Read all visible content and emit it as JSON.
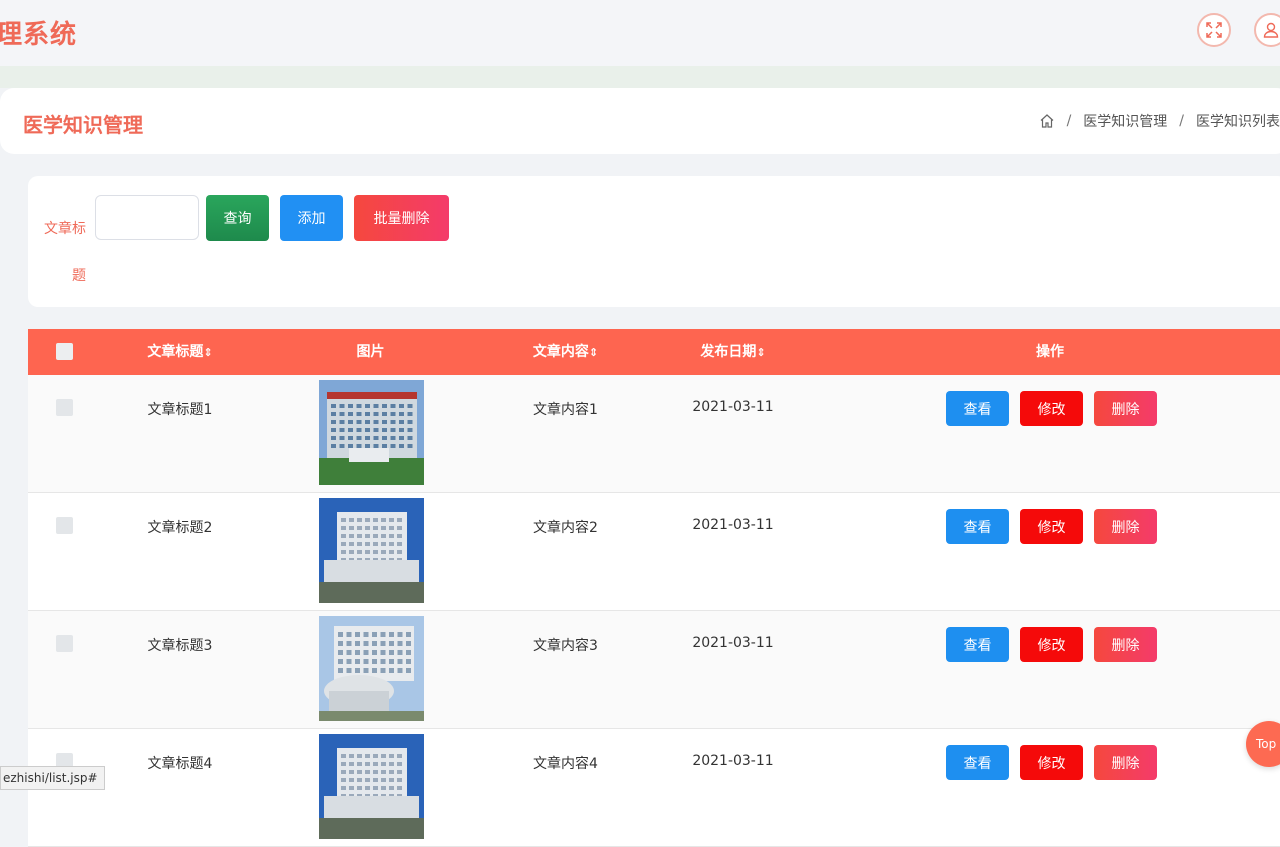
{
  "app": {
    "title": "理系统"
  },
  "header": {
    "page_title": "医学知识管理",
    "breadcrumb": [
      "医学知识管理",
      "医学知识列表"
    ]
  },
  "search": {
    "label": "文章标题",
    "input_value": "",
    "query_label": "查询",
    "add_label": "添加",
    "batch_delete_label": "批量删除"
  },
  "table": {
    "columns": [
      "文章标题",
      "图片",
      "文章内容",
      "发布日期",
      "操作"
    ],
    "sort_glyph": "⇕",
    "rows": [
      {
        "title": "文章标题1",
        "content": "文章内容1",
        "date": "2021-03-11",
        "image": "hospital-building-1"
      },
      {
        "title": "文章标题2",
        "content": "文章内容2",
        "date": "2021-03-11",
        "image": "hospital-building-2"
      },
      {
        "title": "文章标题3",
        "content": "文章内容3",
        "date": "2021-03-11",
        "image": "hospital-building-3"
      },
      {
        "title": "文章标题4",
        "content": "文章内容4",
        "date": "2021-03-11",
        "image": "hospital-building-2"
      }
    ],
    "actions": {
      "view": "查看",
      "edit": "修改",
      "delete": "删除"
    }
  },
  "back_to_top": "Top",
  "status_bar": {
    "url": "ezhishi/list.jsp#"
  },
  "colors": {
    "accent": "#ef6a58",
    "header_bg": "#fe6550",
    "primary": "#2190f3",
    "danger": "#f50a0a",
    "success": "#2aa65c"
  },
  "icons": [
    "fullscreen-icon",
    "user-icon",
    "home-icon",
    "checkbox-icon"
  ]
}
